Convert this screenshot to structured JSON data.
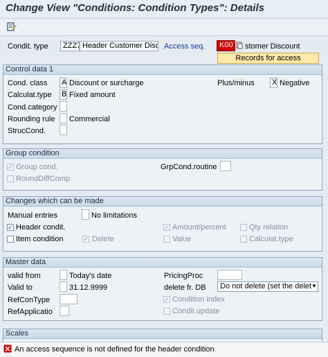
{
  "window": {
    "title": "Change View \"Conditions: Condition Types\": Details"
  },
  "toolbar": {
    "icon": "display-change-icon"
  },
  "header": {
    "condit_type_label": "Condit. type",
    "condit_type_value": "ZZZ7",
    "condit_type_desc": "Header Customer Disc",
    "access_seq_label": "Access seq.",
    "access_seq_value": "K007",
    "access_seq_desc": "stomer Discount",
    "records_button": "Records for access"
  },
  "control_data": {
    "title": "Control data 1",
    "cond_class_label": "Cond. class",
    "cond_class_value": "A",
    "cond_class_desc": "Discount or surcharge",
    "calc_type_label": "Calculat.type",
    "calc_type_value": "B",
    "calc_type_desc": "Fixed amount",
    "cond_category_label": "Cond.category",
    "rounding_label": "Rounding rule",
    "rounding_desc": "Commercial",
    "struc_label": "StrucCond.",
    "plusminus_label": "Plus/minus",
    "plusminus_value": "X",
    "plusminus_desc": "Negative"
  },
  "group_condition": {
    "title": "Group condition",
    "group_cond_label": "Group cond.",
    "group_cond_checked": true,
    "round_diff_label": "RoundDiffComp",
    "grp_routine_label": "GrpCond.routine"
  },
  "changes": {
    "title": "Changes which can be made",
    "manual_label": "Manual entries",
    "manual_desc": "No limitations",
    "header_cond_label": "Header condit.",
    "item_cond_label": "Item condition",
    "delete_label": "Delete",
    "amount_label": "Amount/percent",
    "value_label": "Value",
    "qty_label": "Qty relation",
    "calc_label": "Calculat.type"
  },
  "master": {
    "title": "Master data",
    "valid_from_label": "valid from",
    "valid_from_desc": "Today's date",
    "valid_to_label": "Valid to",
    "valid_to_value": "31.12.9999",
    "refcon_label": "RefConType",
    "refapp_label": "RefApplicatio",
    "pricing_label": "PricingProc",
    "delete_fr_label": "delete fr. DB",
    "delete_fr_value": "Do not delete (set the delet",
    "cond_index_label": "Condition index",
    "cond_update_label": "Condit.update"
  },
  "scales": {
    "title": "Scales"
  },
  "status": {
    "message": "An access sequence is not defined for the header condition"
  },
  "colors": {
    "error": "#cc0000",
    "accent": "#1a3c8a",
    "button_bg": "#fde9a8"
  }
}
